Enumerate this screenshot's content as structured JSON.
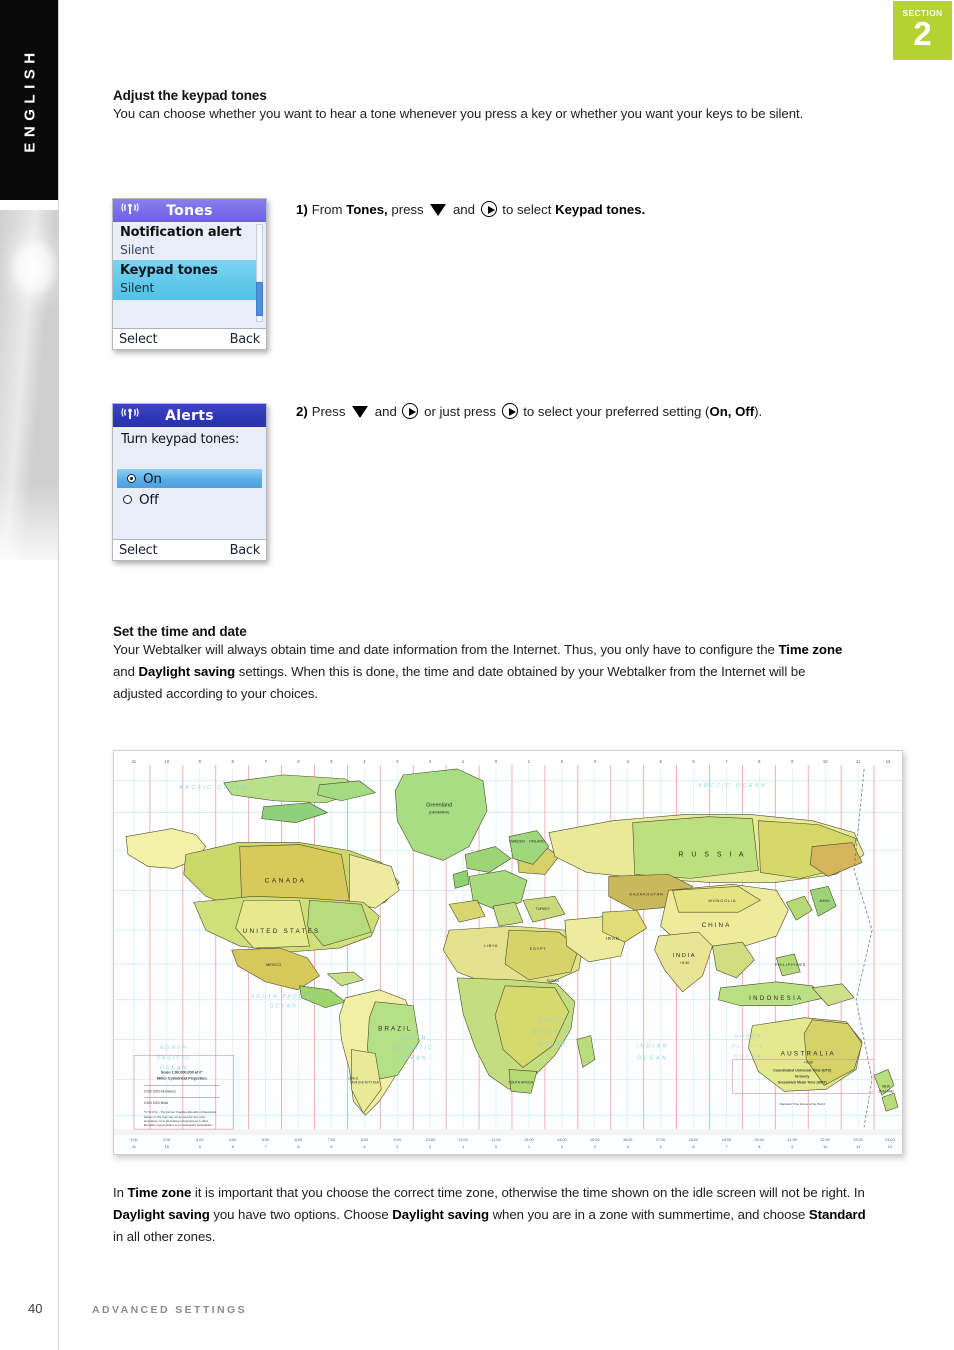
{
  "page": {
    "language_tab": "ENGLISH",
    "section_word": "SECTION",
    "section_number": "2",
    "accent_green": "#b5d134",
    "footer_page_number": "40",
    "footer_label": "ADVANCED SETTINGS"
  },
  "intro": {
    "heading": "Adjust the keypad tones",
    "body_line1": "You can choose whether you want to hear a tone whenever you press a key or whether you want your keys",
    "body_line2": "to be silent."
  },
  "steps": [
    {
      "number": "1)",
      "text_a": "From ",
      "bold_a": "Tones,",
      "text_b": " press ",
      "icon_1": "triangle-down-icon",
      "text_c": " and ",
      "icon_2": "circle-right-arrow-icon",
      "text_d": " to select ",
      "bold_b": "Keypad tones."
    },
    {
      "number": "2)",
      "text_a": "Press ",
      "icon_1": "triangle-down-icon",
      "text_b": " and ",
      "icon_2": "circle-right-arrow-icon",
      "text_c": " or just press ",
      "icon_3": "circle-right-arrow-icon",
      "text_d": " to select your preferred setting (",
      "bold_a": "On, Off",
      "text_e": ")."
    }
  ],
  "phone_screens": [
    {
      "title": "Tones",
      "signal_icon": "antenna-signal-icon",
      "title_color": "#7b6ee8",
      "rows": [
        {
          "label": "Notification alert",
          "value": "Silent",
          "selected": false
        },
        {
          "label": "Keypad tones",
          "value": "Silent",
          "selected": true
        }
      ],
      "softkey_left": "Select",
      "softkey_right": "Back",
      "scrollbar": true
    },
    {
      "title": "Alerts",
      "signal_icon": "antenna-signal-icon",
      "title_color": "#2f37b8",
      "question": "Turn keypad tones:",
      "options": [
        {
          "label": "On",
          "selected": true
        },
        {
          "label": "Off",
          "selected": false
        }
      ],
      "softkey_left": "Select",
      "softkey_right": "Back"
    }
  ],
  "time_section": {
    "heading": "Set the time and date",
    "p1_a": "Your Webtalker will always obtain time and date information from the Internet. Thus, you only have to configure the ",
    "p1_b1": "Time zone",
    "p1_c": " and ",
    "p1_b2": "Daylight saving",
    "p1_d": " settings. When this is done, the time and date obtained by your Webtalker from the Internet will be adjusted according to your choices."
  },
  "closing_section": {
    "c_a": "In ",
    "c_b1": "Time zone",
    "c_c": " it is important that you choose the correct time zone, otherwise the time shown on the idle screen will not be right. In ",
    "c_b2": "Daylight saving",
    "c_d": " you have two options. Choose ",
    "c_b3": "Daylight saving",
    "c_e": " when you are in a zone with summertime, and choose ",
    "c_b4": "Standard",
    "c_f": " in all other zones."
  },
  "map": {
    "alt": "world-time-zone-map",
    "ocean_labels": [
      "ARCTIC OCEAN",
      "NORTH PACIFIC OCEAN",
      "NORTH ATLANTIC OCEAN",
      "SOUTH PACIFIC OCEAN",
      "SOUTH ATLANTIC OCEAN",
      "INDIAN OCEAN"
    ],
    "country_labels": [
      "CANADA",
      "UNITED STATES",
      "GREENLAND",
      "BRAZIL",
      "RUSSIA",
      "CHINA",
      "INDIA",
      "INDONESIA",
      "AUSTRALIA",
      "MONGOLIA",
      "KAZAKHSTAN",
      "IRAN",
      "EGYPT",
      "LIBYA",
      "SUDAN",
      "ARGENTINA",
      "SOUTH AFRICA",
      "PHILIPPINES",
      "NEW ZEALAND",
      "MEXICO",
      "CHILE",
      "TURKEY",
      "SWEDEN",
      "FINLAND",
      "JAPAN"
    ],
    "zone_offsets": [
      "-11",
      "-10",
      "-9",
      "-8",
      "-7",
      "-6",
      "-5",
      "-4",
      "-3",
      "-2",
      "-1",
      "0",
      "+1",
      "+2",
      "+3",
      "+4",
      "+5",
      "+6",
      "+7",
      "+8",
      "+9",
      "+10",
      "+11",
      "+12"
    ],
    "legend_title": "Coordinated Universal Time (UTC)",
    "legend_sub": "formerly Greenwich Mean Time (GMT)",
    "scale_note": "Scale 1:80,000,000 at 0° Miller Cylindrical Projection"
  }
}
